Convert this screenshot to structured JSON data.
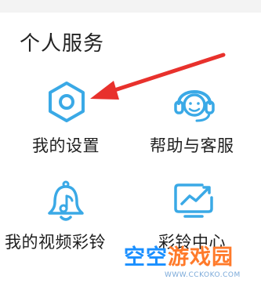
{
  "section": {
    "title": "个人服务"
  },
  "services": [
    {
      "label": "我的设置",
      "icon": "settings-gear-icon"
    },
    {
      "label": "帮助与客服",
      "icon": "customer-service-icon"
    },
    {
      "label": "我的视频彩铃",
      "icon": "video-ringtone-bell-icon"
    },
    {
      "label": "彩铃中心",
      "icon": "ringtone-center-chart-icon"
    }
  ],
  "watermark": {
    "brand_part1": "空空",
    "brand_part2": "游戏园",
    "url": "WWW.CCKOKO.COM"
  },
  "colors": {
    "icon_accent": "#3aa9e6",
    "arrow": "#e8312c",
    "watermark_blue": "#1a8fff",
    "watermark_orange": "#ff7a2a"
  }
}
